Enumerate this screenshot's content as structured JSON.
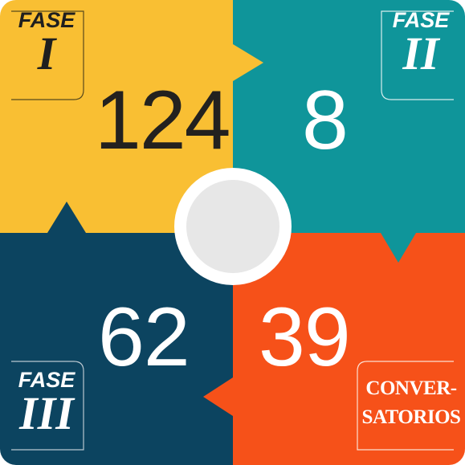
{
  "colors": {
    "quadrant_top_left": "#f9bf33",
    "quadrant_top_right": "#0f959a",
    "quadrant_bottom_left": "#0c4460",
    "quadrant_bottom_right": "#f65119",
    "center_circle": "#e7e7e7"
  },
  "quadrants": {
    "top_left": {
      "value": "124",
      "label_word": "FASE",
      "label_roman": "I"
    },
    "top_right": {
      "value": "8",
      "label_word": "FASE",
      "label_roman": "II"
    },
    "bottom_left": {
      "value": "62",
      "label_word": "FASE",
      "label_roman": "III"
    },
    "bottom_right": {
      "value": "39",
      "label_line1": "CONVER-",
      "label_line2": "SATORIOS"
    }
  }
}
